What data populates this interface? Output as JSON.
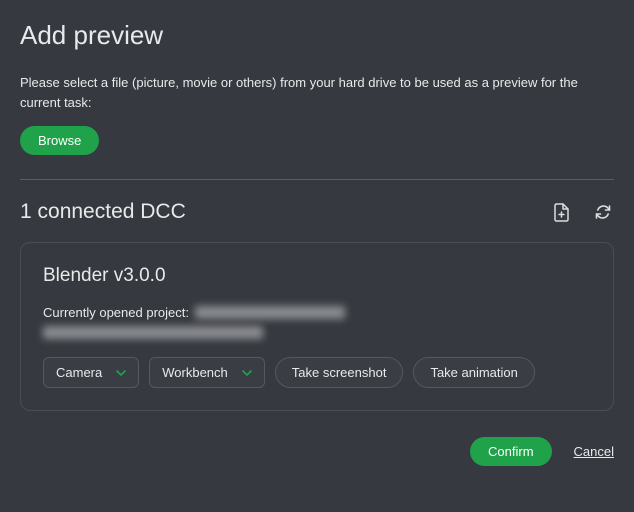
{
  "title": "Add preview",
  "instructions": "Please select a file (picture, movie or others) from your hard drive to be used as a preview for the current task:",
  "browse_label": "Browse",
  "dcc_header": "1 connected DCC",
  "dcc": {
    "name": "Blender v3.0.0",
    "project_label": "Currently opened project:",
    "camera_label": "Camera",
    "renderer_label": "Workbench",
    "screenshot_label": "Take screenshot",
    "animation_label": "Take animation"
  },
  "confirm_label": "Confirm",
  "cancel_label": "Cancel"
}
